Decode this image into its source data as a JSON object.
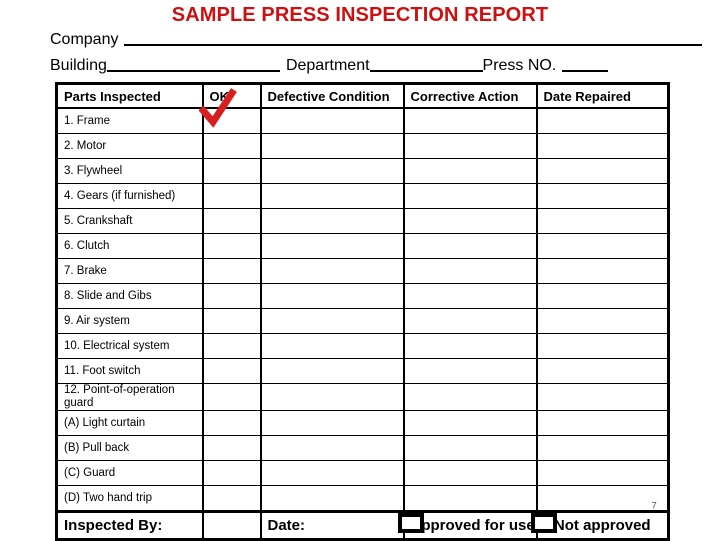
{
  "document": {
    "title": "SAMPLE PRESS INSPECTION REPORT",
    "title_color": "#CC1111",
    "page_number": "7"
  },
  "header_fields": [
    {
      "label": "Company",
      "value": ""
    },
    {
      "label": "Building",
      "value": ""
    },
    {
      "label": "Department",
      "value": ""
    },
    {
      "label": "Press NO.",
      "value": ""
    }
  ],
  "table": {
    "columns": [
      "Parts Inspected",
      "OK",
      "Defective Condition",
      "Corrective Action",
      "Date Repaired"
    ],
    "rows": [
      {
        "part": "1. Frame",
        "ok": "",
        "defective_condition": "",
        "corrective_action": "",
        "date_repaired": ""
      },
      {
        "part": "2. Motor",
        "ok": "",
        "defective_condition": "",
        "corrective_action": "",
        "date_repaired": ""
      },
      {
        "part": "3. Flywheel",
        "ok": "",
        "defective_condition": "",
        "corrective_action": "",
        "date_repaired": ""
      },
      {
        "part": "4. Gears (if furnished)",
        "ok": "",
        "defective_condition": "",
        "corrective_action": "",
        "date_repaired": ""
      },
      {
        "part": "5. Crankshaft",
        "ok": "",
        "defective_condition": "",
        "corrective_action": "",
        "date_repaired": ""
      },
      {
        "part": "6. Clutch",
        "ok": "",
        "defective_condition": "",
        "corrective_action": "",
        "date_repaired": ""
      },
      {
        "part": "7. Brake",
        "ok": "",
        "defective_condition": "",
        "corrective_action": "",
        "date_repaired": ""
      },
      {
        "part": "8. Slide and Gibs",
        "ok": "",
        "defective_condition": "",
        "corrective_action": "",
        "date_repaired": ""
      },
      {
        "part": "9. Air system",
        "ok": "",
        "defective_condition": "",
        "corrective_action": "",
        "date_repaired": ""
      },
      {
        "part": "10. Electrical system",
        "ok": "",
        "defective_condition": "",
        "corrective_action": "",
        "date_repaired": ""
      },
      {
        "part": "11. Foot switch",
        "ok": "",
        "defective_condition": "",
        "corrective_action": "",
        "date_repaired": ""
      },
      {
        "part": "12. Point-of-operation guard",
        "ok": "",
        "defective_condition": "",
        "corrective_action": "",
        "date_repaired": ""
      },
      {
        "part": "(A) Light curtain",
        "ok": "",
        "defective_condition": "",
        "corrective_action": "",
        "date_repaired": ""
      },
      {
        "part": "(B) Pull back",
        "ok": "",
        "defective_condition": "",
        "corrective_action": "",
        "date_repaired": ""
      },
      {
        "part": "(C) Guard",
        "ok": "",
        "defective_condition": "",
        "corrective_action": "",
        "date_repaired": ""
      },
      {
        "part": "(D) Two hand trip",
        "ok": "",
        "defective_condition": "",
        "corrective_action": "",
        "date_repaired": ""
      }
    ]
  },
  "footer": {
    "inspected_by_label": "Inspected By:",
    "inspected_by_value": "",
    "ok_value": "",
    "date_label": "Date:",
    "date_value": "",
    "approved_label": "Approved for use",
    "not_approved_label": "Not approved",
    "approved_checked": false,
    "not_approved_checked": false
  },
  "annotations": {
    "ok_checkmark": {
      "symbol": "check-mark",
      "color": "#D81F1F",
      "applies_to_row": "1. Frame",
      "applies_to_column": "OK"
    }
  }
}
